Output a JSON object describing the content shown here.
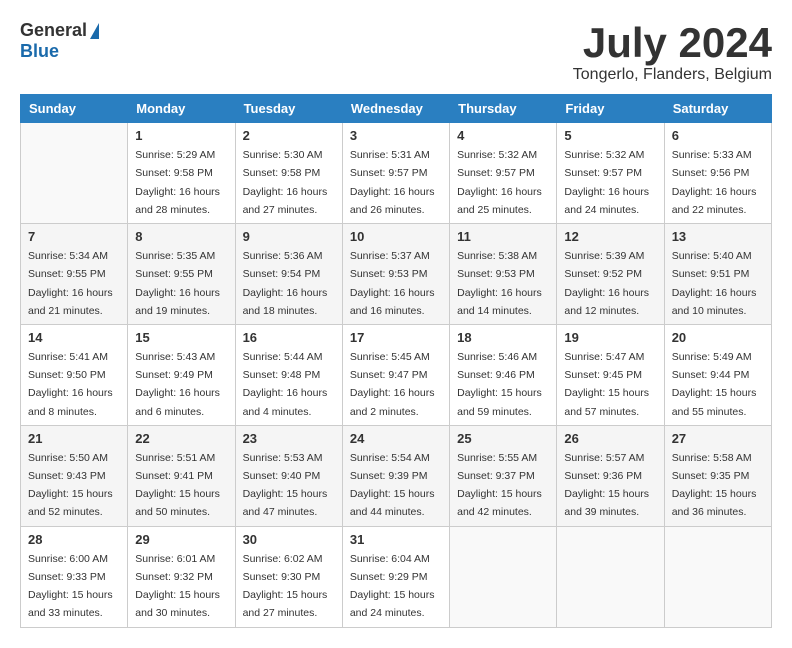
{
  "header": {
    "logo_general": "General",
    "logo_blue": "Blue",
    "month_year": "July 2024",
    "location": "Tongerlo, Flanders, Belgium"
  },
  "days_of_week": [
    "Sunday",
    "Monday",
    "Tuesday",
    "Wednesday",
    "Thursday",
    "Friday",
    "Saturday"
  ],
  "weeks": [
    {
      "bg": "even",
      "days": [
        {
          "num": "",
          "sunrise": "",
          "sunset": "",
          "daylight": ""
        },
        {
          "num": "1",
          "sunrise": "Sunrise: 5:29 AM",
          "sunset": "Sunset: 9:58 PM",
          "daylight": "Daylight: 16 hours and 28 minutes."
        },
        {
          "num": "2",
          "sunrise": "Sunrise: 5:30 AM",
          "sunset": "Sunset: 9:58 PM",
          "daylight": "Daylight: 16 hours and 27 minutes."
        },
        {
          "num": "3",
          "sunrise": "Sunrise: 5:31 AM",
          "sunset": "Sunset: 9:57 PM",
          "daylight": "Daylight: 16 hours and 26 minutes."
        },
        {
          "num": "4",
          "sunrise": "Sunrise: 5:32 AM",
          "sunset": "Sunset: 9:57 PM",
          "daylight": "Daylight: 16 hours and 25 minutes."
        },
        {
          "num": "5",
          "sunrise": "Sunrise: 5:32 AM",
          "sunset": "Sunset: 9:57 PM",
          "daylight": "Daylight: 16 hours and 24 minutes."
        },
        {
          "num": "6",
          "sunrise": "Sunrise: 5:33 AM",
          "sunset": "Sunset: 9:56 PM",
          "daylight": "Daylight: 16 hours and 22 minutes."
        }
      ]
    },
    {
      "bg": "odd",
      "days": [
        {
          "num": "7",
          "sunrise": "Sunrise: 5:34 AM",
          "sunset": "Sunset: 9:55 PM",
          "daylight": "Daylight: 16 hours and 21 minutes."
        },
        {
          "num": "8",
          "sunrise": "Sunrise: 5:35 AM",
          "sunset": "Sunset: 9:55 PM",
          "daylight": "Daylight: 16 hours and 19 minutes."
        },
        {
          "num": "9",
          "sunrise": "Sunrise: 5:36 AM",
          "sunset": "Sunset: 9:54 PM",
          "daylight": "Daylight: 16 hours and 18 minutes."
        },
        {
          "num": "10",
          "sunrise": "Sunrise: 5:37 AM",
          "sunset": "Sunset: 9:53 PM",
          "daylight": "Daylight: 16 hours and 16 minutes."
        },
        {
          "num": "11",
          "sunrise": "Sunrise: 5:38 AM",
          "sunset": "Sunset: 9:53 PM",
          "daylight": "Daylight: 16 hours and 14 minutes."
        },
        {
          "num": "12",
          "sunrise": "Sunrise: 5:39 AM",
          "sunset": "Sunset: 9:52 PM",
          "daylight": "Daylight: 16 hours and 12 minutes."
        },
        {
          "num": "13",
          "sunrise": "Sunrise: 5:40 AM",
          "sunset": "Sunset: 9:51 PM",
          "daylight": "Daylight: 16 hours and 10 minutes."
        }
      ]
    },
    {
      "bg": "even",
      "days": [
        {
          "num": "14",
          "sunrise": "Sunrise: 5:41 AM",
          "sunset": "Sunset: 9:50 PM",
          "daylight": "Daylight: 16 hours and 8 minutes."
        },
        {
          "num": "15",
          "sunrise": "Sunrise: 5:43 AM",
          "sunset": "Sunset: 9:49 PM",
          "daylight": "Daylight: 16 hours and 6 minutes."
        },
        {
          "num": "16",
          "sunrise": "Sunrise: 5:44 AM",
          "sunset": "Sunset: 9:48 PM",
          "daylight": "Daylight: 16 hours and 4 minutes."
        },
        {
          "num": "17",
          "sunrise": "Sunrise: 5:45 AM",
          "sunset": "Sunset: 9:47 PM",
          "daylight": "Daylight: 16 hours and 2 minutes."
        },
        {
          "num": "18",
          "sunrise": "Sunrise: 5:46 AM",
          "sunset": "Sunset: 9:46 PM",
          "daylight": "Daylight: 15 hours and 59 minutes."
        },
        {
          "num": "19",
          "sunrise": "Sunrise: 5:47 AM",
          "sunset": "Sunset: 9:45 PM",
          "daylight": "Daylight: 15 hours and 57 minutes."
        },
        {
          "num": "20",
          "sunrise": "Sunrise: 5:49 AM",
          "sunset": "Sunset: 9:44 PM",
          "daylight": "Daylight: 15 hours and 55 minutes."
        }
      ]
    },
    {
      "bg": "odd",
      "days": [
        {
          "num": "21",
          "sunrise": "Sunrise: 5:50 AM",
          "sunset": "Sunset: 9:43 PM",
          "daylight": "Daylight: 15 hours and 52 minutes."
        },
        {
          "num": "22",
          "sunrise": "Sunrise: 5:51 AM",
          "sunset": "Sunset: 9:41 PM",
          "daylight": "Daylight: 15 hours and 50 minutes."
        },
        {
          "num": "23",
          "sunrise": "Sunrise: 5:53 AM",
          "sunset": "Sunset: 9:40 PM",
          "daylight": "Daylight: 15 hours and 47 minutes."
        },
        {
          "num": "24",
          "sunrise": "Sunrise: 5:54 AM",
          "sunset": "Sunset: 9:39 PM",
          "daylight": "Daylight: 15 hours and 44 minutes."
        },
        {
          "num": "25",
          "sunrise": "Sunrise: 5:55 AM",
          "sunset": "Sunset: 9:37 PM",
          "daylight": "Daylight: 15 hours and 42 minutes."
        },
        {
          "num": "26",
          "sunrise": "Sunrise: 5:57 AM",
          "sunset": "Sunset: 9:36 PM",
          "daylight": "Daylight: 15 hours and 39 minutes."
        },
        {
          "num": "27",
          "sunrise": "Sunrise: 5:58 AM",
          "sunset": "Sunset: 9:35 PM",
          "daylight": "Daylight: 15 hours and 36 minutes."
        }
      ]
    },
    {
      "bg": "even",
      "days": [
        {
          "num": "28",
          "sunrise": "Sunrise: 6:00 AM",
          "sunset": "Sunset: 9:33 PM",
          "daylight": "Daylight: 15 hours and 33 minutes."
        },
        {
          "num": "29",
          "sunrise": "Sunrise: 6:01 AM",
          "sunset": "Sunset: 9:32 PM",
          "daylight": "Daylight: 15 hours and 30 minutes."
        },
        {
          "num": "30",
          "sunrise": "Sunrise: 6:02 AM",
          "sunset": "Sunset: 9:30 PM",
          "daylight": "Daylight: 15 hours and 27 minutes."
        },
        {
          "num": "31",
          "sunrise": "Sunrise: 6:04 AM",
          "sunset": "Sunset: 9:29 PM",
          "daylight": "Daylight: 15 hours and 24 minutes."
        },
        {
          "num": "",
          "sunrise": "",
          "sunset": "",
          "daylight": ""
        },
        {
          "num": "",
          "sunrise": "",
          "sunset": "",
          "daylight": ""
        },
        {
          "num": "",
          "sunrise": "",
          "sunset": "",
          "daylight": ""
        }
      ]
    }
  ]
}
